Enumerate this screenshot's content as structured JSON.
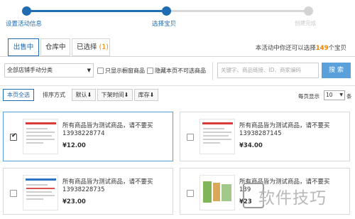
{
  "steps": [
    {
      "label": "设置活动信息",
      "state": "done"
    },
    {
      "label": "选择宝贝",
      "state": "active"
    },
    {
      "label": "创建完成",
      "state": "pending"
    }
  ],
  "colors": {
    "primary": "#1f6cb3",
    "accent": "#f08300",
    "search_button": "#5aa1dc",
    "inactive": "#d4d4d4"
  },
  "tabs": {
    "on_sale": "出售中",
    "warehouse": "仓库中",
    "selected_prefix": "已选择",
    "selected_count": "(1)"
  },
  "quota": {
    "prefix": "本活动中你还可以选择",
    "count": "149",
    "suffix": "个宝贝"
  },
  "filters": {
    "category_value": "全部店铺手动分类",
    "show_window_only": "只显示橱窗商品",
    "hide_unselectable": "隐藏本页不可选商品",
    "search_placeholder": "关键字、商品链接、ID、商家编码",
    "search_button": "搜 索"
  },
  "toolbar": {
    "select_all": "本页全选",
    "sort_label": "排序方式",
    "sort_default": "默认",
    "sort_time": "下架时间",
    "sort_stock": "库存",
    "per_page_label": "每页显示",
    "per_page_value": "10",
    "per_page_unit": "条"
  },
  "products": [
    {
      "title": "所有商品皆为测试商品，请不要买",
      "phone": "13938228774",
      "price": "¥12.00",
      "checked": true,
      "thumb": "form-icon"
    },
    {
      "title": "所有商品皆为测试商品，请不要买",
      "phone": "13938287145",
      "price": "¥34.00",
      "checked": false,
      "thumb": "form-icon"
    },
    {
      "title": "所有商品皆为测试商品，请不要买",
      "phone": "13938228735",
      "price": "¥23.00",
      "checked": false,
      "thumb": "form-icon"
    },
    {
      "title": "所有商品皆为测试商品，请不要买",
      "phone": "139",
      "price": "¥23",
      "checked": false,
      "thumb": "image-icon"
    }
  ],
  "watermark": "软件技巧"
}
